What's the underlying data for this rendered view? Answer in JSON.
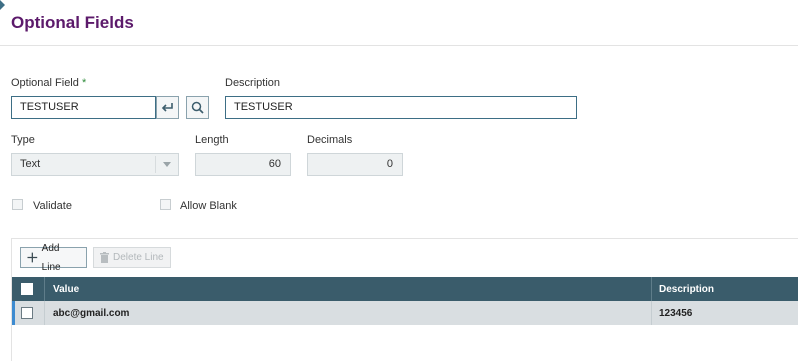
{
  "page": {
    "title": "Optional Fields"
  },
  "optional_field": {
    "label": "Optional Field",
    "required_mark": "*",
    "value": "TESTUSER",
    "enter_icon": "enter-return-icon",
    "search_icon": "magnifier-icon"
  },
  "description": {
    "label": "Description",
    "value": "TESTUSER"
  },
  "type": {
    "label": "Type",
    "value": "Text",
    "arrow_icon": "dropdown-arrow-icon"
  },
  "length": {
    "label": "Length",
    "value": "60"
  },
  "decimals": {
    "label": "Decimals",
    "value": "0"
  },
  "validate": {
    "label": "Validate",
    "checked": false
  },
  "allow_blank": {
    "label": "Allow Blank",
    "checked": false
  },
  "grid": {
    "toolbar": {
      "add_label": "Add Line",
      "add_icon": "plus-icon",
      "delete_label": "Delete Line",
      "delete_icon": "trash-icon"
    },
    "columns": [
      "Value",
      "Description"
    ],
    "rows": [
      {
        "value": "abc@gmail.com",
        "description": "123456",
        "selected": false
      }
    ]
  },
  "colors": {
    "title": "#5c1a6b",
    "grid_header": "#3a5c6b",
    "row_bg": "#d9dee1",
    "row_marker": "#3d8bd0",
    "required": "#2e8b3a",
    "input_border": "#3d6e85"
  }
}
